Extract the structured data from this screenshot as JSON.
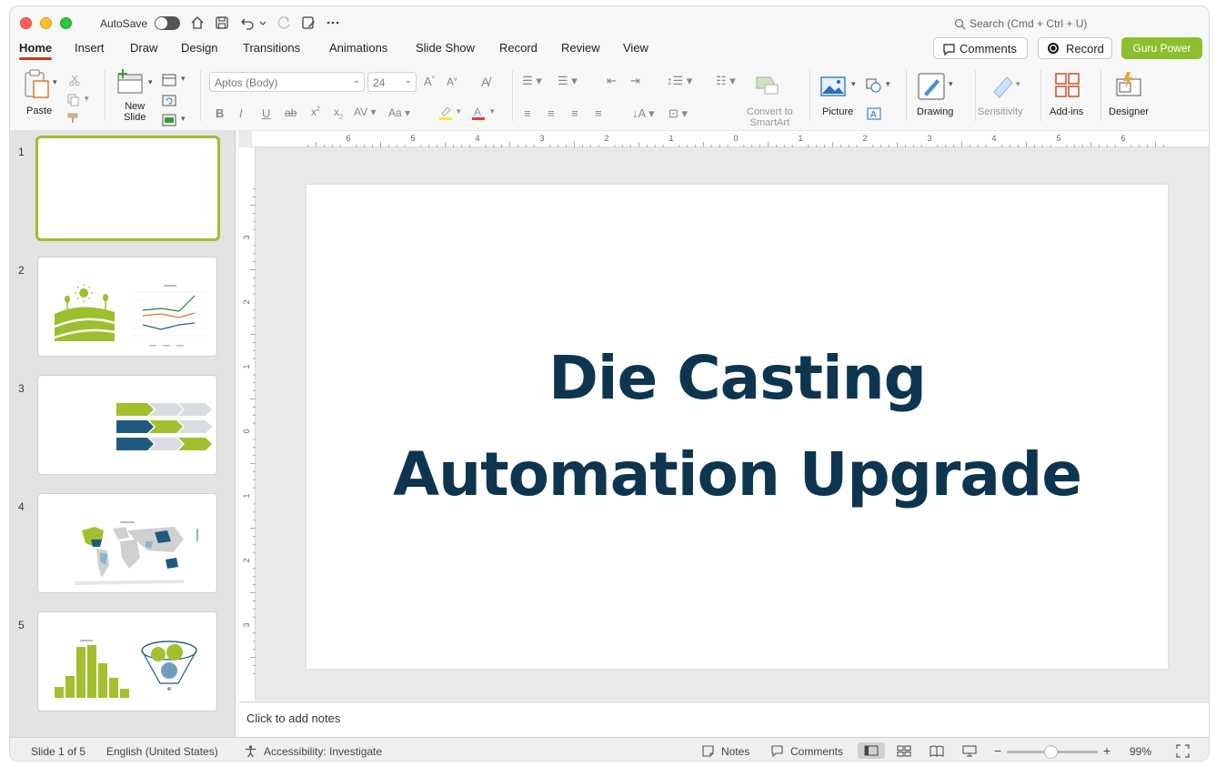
{
  "titlebar": {
    "autosave_label": "AutoSave",
    "search_placeholder": "Search (Cmd + Ctrl + U)"
  },
  "menu": {
    "tabs": [
      "Home",
      "Insert",
      "Draw",
      "Design",
      "Transitions",
      "Animations",
      "Slide Show",
      "Record",
      "Review",
      "View"
    ],
    "active_tab": "Home",
    "comments_label": "Comments",
    "record_label": "Record",
    "guru_label": "Guru Power"
  },
  "ribbon": {
    "paste_label": "Paste",
    "new_slide_label": "New\nSlide",
    "font_name": "Aptos (Body)",
    "font_size": "24",
    "convert_label": "Convert to\nSmartArt",
    "picture_label": "Picture",
    "drawing_label": "Drawing",
    "sensitivity_label": "Sensitivity",
    "addins_label": "Add-ins",
    "designer_label": "Designer"
  },
  "thumbnails": [
    {
      "number": "1"
    },
    {
      "number": "2"
    },
    {
      "number": "3"
    },
    {
      "number": "4"
    },
    {
      "number": "5"
    }
  ],
  "slide": {
    "title_line1": "Die Casting",
    "title_line2": "Automation Upgrade",
    "title_color": "#0d3550"
  },
  "notes": {
    "placeholder": "Click to add notes"
  },
  "status": {
    "slide_counter": "Slide 1 of 5",
    "language": "English (United States)",
    "accessibility": "Accessibility: Investigate",
    "notes_label": "Notes",
    "comments_label": "Comments",
    "zoom": "99%"
  },
  "ruler": {
    "h_labels": [
      "6",
      "5",
      "4",
      "3",
      "2",
      "1",
      "0",
      "1",
      "2",
      "3",
      "4",
      "5",
      "6"
    ],
    "v_labels": [
      "3",
      "2",
      "1",
      "0",
      "1",
      "2",
      "3"
    ]
  },
  "colors": {
    "accent_green": "#8cbf2e",
    "dark_blue": "#1f5b7f",
    "light_gray": "#d8dde3",
    "tab_underline": "#c43e1c"
  }
}
